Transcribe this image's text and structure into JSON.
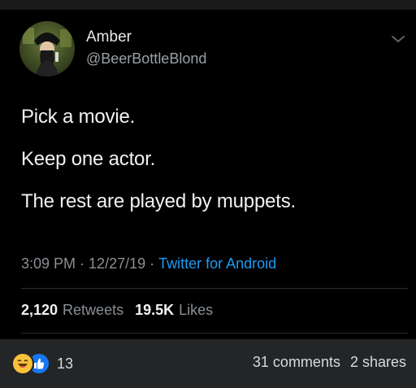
{
  "tweet": {
    "display_name": "Amber",
    "handle": "@BeerBottleBlond",
    "lines": [
      "Pick a movie.",
      "Keep one actor.",
      "The rest are played by muppets."
    ],
    "time": "3:09 PM",
    "date": "12/27/19",
    "source": "Twitter for Android",
    "retweets_count": "2,120",
    "retweets_label": "Retweets",
    "likes_count": "19.5K",
    "likes_label": "Likes",
    "avatar_icon": "user-avatar-icon",
    "menu_icon": "chevron-down-icon"
  },
  "facebook_bar": {
    "reaction_icons": [
      "haha-reaction-icon",
      "like-reaction-icon"
    ],
    "reaction_count": "13",
    "comments": "31 comments",
    "shares": "2 shares"
  },
  "colors": {
    "background": "#000000",
    "text": "#f2f2f2",
    "muted": "#8a8f94",
    "link": "#1d9bf0",
    "fb_bar": "#242526",
    "like_blue": "#1877f2",
    "haha_yellow": "#f7c23a"
  }
}
